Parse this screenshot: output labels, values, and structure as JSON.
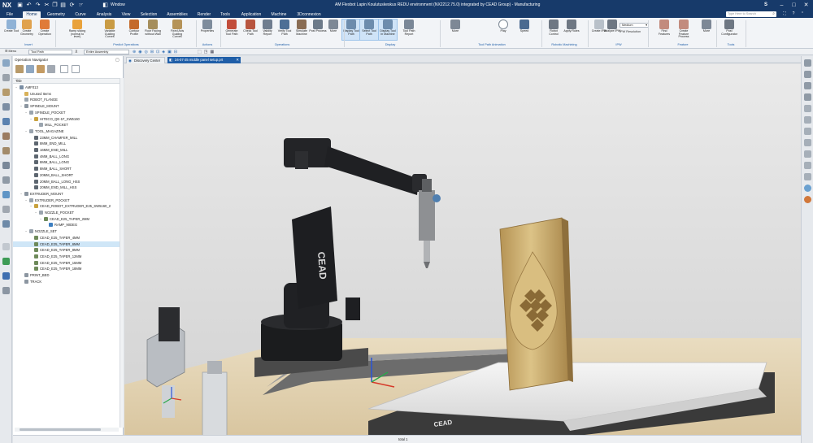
{
  "window": {
    "app_logo": "NX",
    "title": "AM Flexbot Lapin Koulutuskeskus REDU environment (NX2212.75.0) integrated by CEAD Group) - Manufacturing",
    "quick_menu_window": "Window",
    "search_placeholder": "Type Here to Search",
    "account_letter": "S"
  },
  "menu_tabs": [
    "File",
    "Home",
    "Geometry",
    "Curve",
    "Analysis",
    "View",
    "Selection",
    "Assemblies",
    "Render",
    "Tools",
    "Application",
    "Machine",
    "3Dconnexion"
  ],
  "ribbon": {
    "buttons": [
      {
        "label": "Create Tool",
        "icon": "create-tool-icon",
        "color": "#8fb2d6"
      },
      {
        "label": "Create Geometry",
        "icon": "create-geometry-icon",
        "color": "#e0a24e"
      },
      {
        "label": "Create Operation",
        "icon": "create-operation-icon",
        "color": "#e07b38"
      },
      {
        "label": "Ramp slicing (normal to level)",
        "icon": "ramp-slicing-icon",
        "color": "#e9a23b"
      },
      {
        "label": "Variable Guiding Curves",
        "icon": "variable-guiding-curves-icon",
        "color": "#c99b44"
      },
      {
        "label": "Contour Profile",
        "icon": "contour-profile-icon",
        "color": "#c46a2c"
      },
      {
        "label": "Floor Facing without Wall",
        "icon": "floor-facing-icon",
        "color": "#a58e5c"
      },
      {
        "label": "Fixed Axis Guiding Curves",
        "icon": "fixed-axis-icon",
        "color": "#b59358"
      },
      {
        "label": "Properties",
        "icon": "properties-icon",
        "color": "#7e8c9c"
      },
      {
        "label": "Generate Tool Path",
        "icon": "generate-tool-path-icon",
        "color": "#c24d3b"
      },
      {
        "label": "Check Tool Path",
        "icon": "check-tool-path-icon",
        "color": "#b8553f"
      },
      {
        "label": "Validity Report",
        "icon": "validity-report-icon",
        "color": "#6f7d8f"
      },
      {
        "label": "Verify Tool Path",
        "icon": "verify-tool-path-icon",
        "color": "#4d6f96"
      },
      {
        "label": "Simulate Machine",
        "icon": "simulate-machine-icon",
        "color": "#8a6d54"
      },
      {
        "label": "Post Process",
        "icon": "post-process-icon",
        "color": "#6c7a8a"
      },
      {
        "label": "More",
        "icon": "more-icon",
        "color": "#7d8896"
      },
      {
        "label": "Display Tool Path",
        "icon": "display-tool-path-icon",
        "color": "#6d8cad"
      },
      {
        "label": "Select Tool Path",
        "icon": "select-tool-path-icon",
        "color": "#6d8cad"
      },
      {
        "label": "Display Tool in Machine",
        "icon": "display-tool-machine-icon",
        "color": "#6d8cad"
      },
      {
        "label": "Tool Path Report",
        "icon": "tool-path-report-icon",
        "color": "#7a8797"
      },
      {
        "label": "More",
        "icon": "more-icon",
        "color": "#7d8896"
      },
      {
        "label": "Play",
        "icon": "play-icon",
        "color": "#ffffff"
      },
      {
        "label": "Speed",
        "icon": "speed-slider-icon",
        "color": "#4a6a90"
      },
      {
        "label": "Robot Control",
        "icon": "robot-control-icon",
        "color": "#6e7783"
      },
      {
        "label": "Apply Rules",
        "icon": "apply-rules-icon",
        "color": "#6e7783"
      },
      {
        "label": "Create IPW",
        "icon": "create-ipw-icon",
        "color": "#b8c0c9"
      },
      {
        "label": "Analyze IPW",
        "icon": "analyze-ipw-icon",
        "color": "#6e7783"
      },
      {
        "label": "Find Features",
        "icon": "find-features-icon",
        "color": "#c28b7e"
      },
      {
        "label": "Create Feature Process",
        "icon": "create-feature-process-icon",
        "color": "#c28b7e"
      },
      {
        "label": "More",
        "icon": "more-icon",
        "color": "#7d8896"
      },
      {
        "label": "Post Configurator",
        "icon": "post-configurator-icon",
        "color": "#6e7783"
      }
    ],
    "groups": [
      "Insert",
      "Predict Operations",
      "Actions",
      "Operations",
      "Display",
      "Tool Path Animation",
      "Robotic Machining",
      "IPW",
      "Feature",
      "Tools"
    ],
    "ipw_resolution_label": "IPW Resolution",
    "ipw_resolution_value": "Medium"
  },
  "toolbar2": {
    "menu_label": "Menu",
    "filter_value": "Tool Path",
    "scope_value": "Entire Assembly"
  },
  "navigator": {
    "title": "Operation Navigator",
    "column_header": "Title",
    "rows": [
      {
        "label": "AMF013",
        "depth": 0,
        "expanded": true,
        "icon": "root-icon",
        "selected": false
      },
      {
        "label": "Unused Items",
        "depth": 1,
        "expanded": false,
        "icon": "folder-icon",
        "selected": false
      },
      {
        "label": "ROBOT_FLANGE",
        "depth": 1,
        "expanded": false,
        "icon": "pocket-icon",
        "selected": false
      },
      {
        "label": "SPINDLE_MOUNT",
        "depth": 1,
        "expanded": true,
        "icon": "mount-icon",
        "selected": false
      },
      {
        "label": "SPINDLE_POCKET",
        "depth": 2,
        "expanded": true,
        "icon": "pocket-icon",
        "selected": false
      },
      {
        "label": "HITECO_QE-1F_SW5160",
        "depth": 3,
        "expanded": true,
        "icon": "tool-icon",
        "selected": false
      },
      {
        "label": "MILL_POCKET",
        "depth": 4,
        "expanded": false,
        "icon": "pocket-icon",
        "selected": false
      },
      {
        "label": "TOOL_MAGAZINE",
        "depth": 2,
        "expanded": true,
        "icon": "pocket-icon",
        "selected": false
      },
      {
        "label": "23MM_CHAMFER_MILL",
        "depth": 3,
        "expanded": false,
        "icon": "mill-icon",
        "selected": false
      },
      {
        "label": "8MM_END_MILL",
        "depth": 3,
        "expanded": false,
        "icon": "mill-icon",
        "selected": false
      },
      {
        "label": "16MM_END_MILL",
        "depth": 3,
        "expanded": false,
        "icon": "mill-icon",
        "selected": false
      },
      {
        "label": "4MM_BALL_LONG",
        "depth": 3,
        "expanded": false,
        "icon": "mill-icon",
        "selected": false
      },
      {
        "label": "8MM_BALL_LONG",
        "depth": 3,
        "expanded": false,
        "icon": "mill-icon",
        "selected": false
      },
      {
        "label": "8MM_BALL_SHORT",
        "depth": 3,
        "expanded": false,
        "icon": "mill-icon",
        "selected": false
      },
      {
        "label": "20MM_BALL_SHORT",
        "depth": 3,
        "expanded": false,
        "icon": "mill-icon",
        "selected": false
      },
      {
        "label": "20MM_BALL_LONG_HSS",
        "depth": 3,
        "expanded": false,
        "icon": "mill-icon",
        "selected": false
      },
      {
        "label": "20MM_END_MILL_HSS",
        "depth": 3,
        "expanded": false,
        "icon": "mill-icon",
        "selected": false
      },
      {
        "label": "EXTRUDER_MOUNT",
        "depth": 1,
        "expanded": true,
        "icon": "mount-icon",
        "selected": false
      },
      {
        "label": "EXTRUDER_POCKET",
        "depth": 2,
        "expanded": true,
        "icon": "pocket-icon",
        "selected": false
      },
      {
        "label": "CEAD_ROBOT_EXTRUDER_E25_SW5160_2",
        "depth": 3,
        "expanded": true,
        "icon": "tool-icon",
        "selected": false
      },
      {
        "label": "NOZZLE_POCKET",
        "depth": 4,
        "expanded": true,
        "icon": "pocket-icon",
        "selected": false
      },
      {
        "label": "CEAD_E25_TAPER_2MM",
        "depth": 5,
        "expanded": true,
        "icon": "nozzle-icon",
        "selected": false
      },
      {
        "label": "RAMP_90DEG",
        "depth": 6,
        "expanded": false,
        "icon": "operation-icon",
        "selected": false
      },
      {
        "label": "NOZZLE_SET",
        "depth": 2,
        "expanded": true,
        "icon": "pocket-icon",
        "selected": false
      },
      {
        "label": "CEAD_E25_TAPER_4MM",
        "depth": 3,
        "expanded": false,
        "icon": "nozzle-icon",
        "selected": false
      },
      {
        "label": "CEAD_E25_TAPER_6MM",
        "depth": 3,
        "expanded": false,
        "icon": "nozzle-icon",
        "selected": true
      },
      {
        "label": "CEAD_E25_TAPER_8MM",
        "depth": 3,
        "expanded": false,
        "icon": "nozzle-icon",
        "selected": false
      },
      {
        "label": "CEAD_E25_TAPER_12MM",
        "depth": 3,
        "expanded": false,
        "icon": "nozzle-icon",
        "selected": false
      },
      {
        "label": "CEAD_E25_TAPER_15MM",
        "depth": 3,
        "expanded": false,
        "icon": "nozzle-icon",
        "selected": false
      },
      {
        "label": "CEAD_E25_TAPER_18MM",
        "depth": 3,
        "expanded": false,
        "icon": "nozzle-icon",
        "selected": false
      },
      {
        "label": "PRINT_BED",
        "depth": 1,
        "expanded": false,
        "icon": "mount-icon",
        "selected": false
      },
      {
        "label": "TRACK",
        "depth": 1,
        "expanded": false,
        "icon": "mount-icon",
        "selected": false
      }
    ]
  },
  "doc_tabs": [
    {
      "label": "Discovery Center",
      "active": false
    },
    {
      "label": "24-07-25 middle panel setup.prt",
      "active": true
    }
  ],
  "scene": {
    "robot_brand": "CEAD",
    "base_brand": "CEAD"
  },
  "status": {
    "text": "total 1"
  },
  "colors": {
    "titlebar": "#173a6a",
    "accent": "#1f5ea8",
    "selection": "#cfe6f7",
    "robot_black": "#1b1c1e",
    "panel_gold": "#c8a864"
  }
}
